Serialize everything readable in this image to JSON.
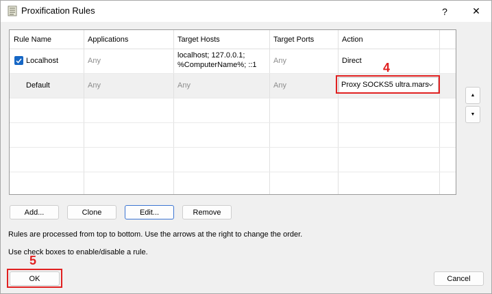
{
  "window": {
    "title": "Proxification Rules",
    "help_label": "?",
    "close_label": "✕"
  },
  "grid": {
    "columns": [
      "Rule Name",
      "Applications",
      "Target Hosts",
      "Target Ports",
      "Action"
    ],
    "rows": [
      {
        "name": "Localhost",
        "checked": true,
        "applications": "Any",
        "hosts_line1": "localhost; 127.0.0.1;",
        "hosts_line2": "%ComputerName%; ::1",
        "ports": "Any",
        "action": "Direct"
      },
      {
        "name": "Default",
        "applications": "Any",
        "hosts": "Any",
        "ports": "Any",
        "action": "Proxy SOCKS5 ultra.mars"
      }
    ]
  },
  "annotations": {
    "step4": "4",
    "step5": "5",
    "color": "#e02020"
  },
  "buttons": {
    "add": "Add...",
    "clone": "Clone",
    "edit": "Edit...",
    "remove": "Remove",
    "ok": "OK",
    "cancel": "Cancel",
    "move_up": "▲",
    "move_down": "▼"
  },
  "info": {
    "line1": "Rules are processed from top to bottom. Use the arrows at the right to change the order.",
    "line2": "Use check boxes to enable/disable a rule."
  },
  "colors": {
    "accent": "#1667c5",
    "focus": "#3b74d2"
  }
}
